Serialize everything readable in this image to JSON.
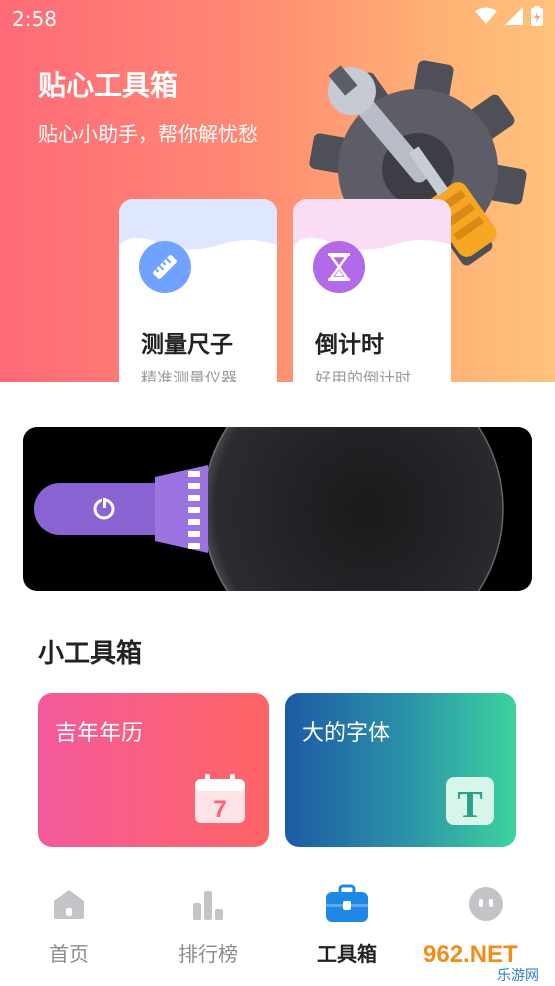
{
  "status_bar": {
    "time": "2:58",
    "icons": [
      "wifi-icon",
      "signal-icon",
      "battery-icon"
    ]
  },
  "header": {
    "title": "贴心工具箱",
    "subtitle": "贴心小助手，帮你解忧愁",
    "illustration": "gear-wrench-icon"
  },
  "feature_cards": [
    {
      "title": "测量尺子",
      "subtitle": "精准测量仪器",
      "icon": "ruler-icon",
      "color": "#6fa3ff"
    },
    {
      "title": "倒计时",
      "subtitle": "好用的倒计时",
      "icon": "hourglass-icon",
      "color": "#b26ae8"
    }
  ],
  "banner": {
    "icon": "flashlight-icon"
  },
  "section": {
    "title": "小工具箱"
  },
  "tools": [
    {
      "label": "吉年年历",
      "icon": "calendar-icon",
      "icon_text": "7",
      "colors": [
        "#f35a9b",
        "#ff6565"
      ]
    },
    {
      "label": "大的字体",
      "icon": "font-icon",
      "icon_text": "T",
      "colors": [
        "#1e5aa5",
        "#3cd3a0"
      ]
    }
  ],
  "tabbar": {
    "items": [
      {
        "label": "首页",
        "icon": "home-icon",
        "active": false
      },
      {
        "label": "排行榜",
        "icon": "bar-chart-icon",
        "active": false
      },
      {
        "label": "工具箱",
        "icon": "toolbox-icon",
        "active": true
      },
      {
        "label": "",
        "icon": "face-icon",
        "active": false
      }
    ]
  },
  "watermark": {
    "text": "962.NET",
    "sub": "乐游网"
  }
}
